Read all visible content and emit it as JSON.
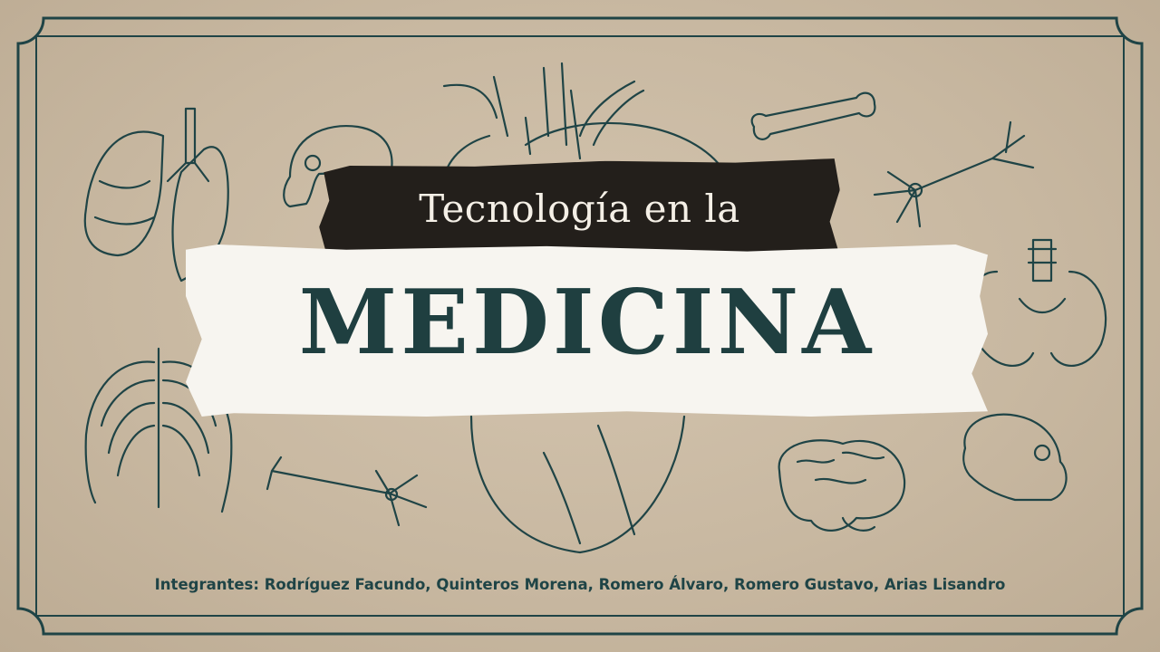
{
  "slide": {
    "subtitle": "Tecnología en la",
    "title": "MEDICINA",
    "members": "Integrantes: Rodríguez Facundo, Quinteros Morena, Romero Álvaro, Romero Gustavo, Arias Lisandro"
  },
  "colors": {
    "background": "#c9b9a3",
    "ink": "#1f3f40",
    "dark_tape": "#231f1b",
    "light_tape": "#f7f5f0"
  },
  "illustrations": [
    "lungs-icon",
    "skull-icon",
    "heart-icon",
    "bone-icon",
    "neuron-icon",
    "pelvis-icon",
    "ribcage-icon",
    "brain-icon"
  ]
}
